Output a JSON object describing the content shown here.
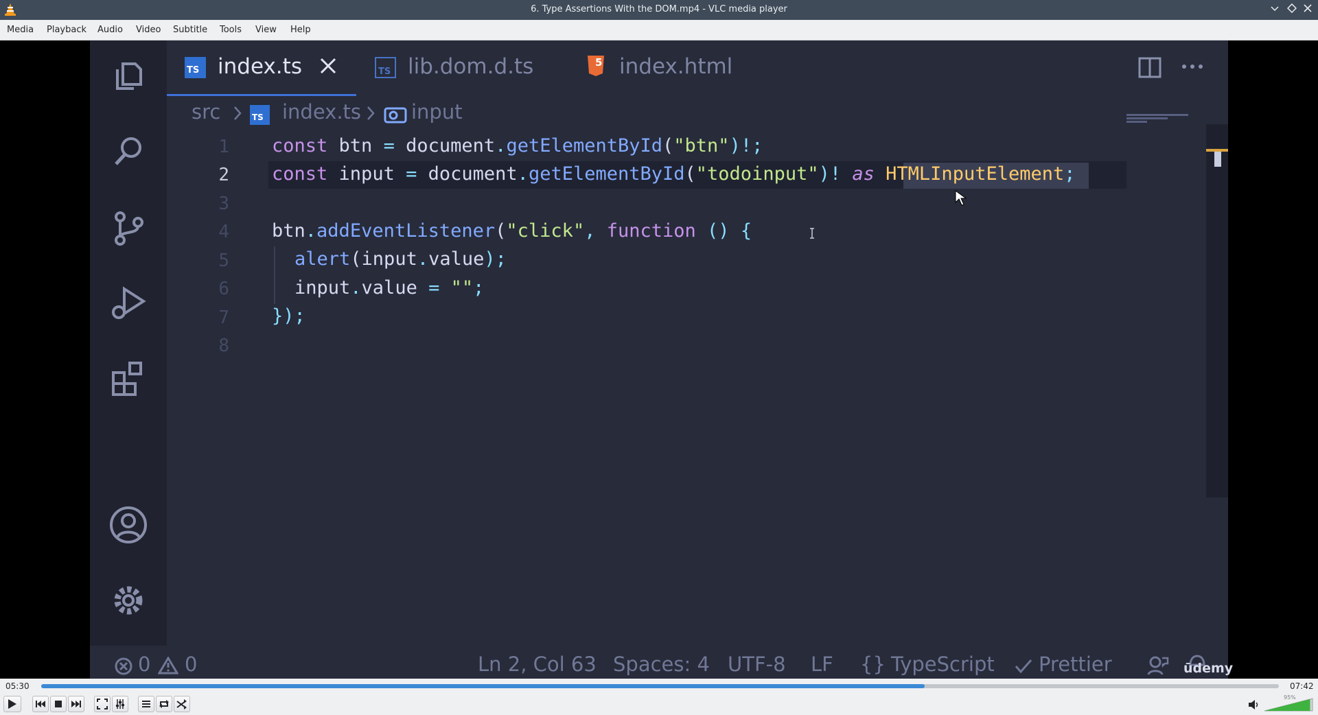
{
  "window": {
    "title": "6. Type Assertions With the DOM.mp4 - VLC media player",
    "app_icon": "vlc-cone-icon",
    "controls": [
      "minimize-icon",
      "maximize-icon",
      "close-icon"
    ]
  },
  "menu": [
    "Media",
    "Playback",
    "Audio",
    "Video",
    "Subtitle",
    "Tools",
    "View",
    "Help"
  ],
  "video_frame": {
    "activity_icons": [
      "explorer-icon",
      "search-icon",
      "source-control-icon",
      "run-debug-icon",
      "extensions-icon",
      "account-icon",
      "settings-gear-icon"
    ],
    "tabs": [
      {
        "label": "index.ts",
        "badge": "TS",
        "active": true
      },
      {
        "label": "lib.dom.d.ts",
        "badge": "TS",
        "active": false
      },
      {
        "label": "index.html",
        "badge": "5",
        "active": false
      }
    ],
    "breadcrumb": {
      "folder": "src",
      "file": "index.ts",
      "symbol": "input",
      "file_badge": "TS"
    },
    "line_numbers": [
      "1",
      "2",
      "3",
      "4",
      "5",
      "6",
      "7",
      "8"
    ],
    "current_line": 2,
    "code": {
      "l1": {
        "kw": "const",
        "name": "btn",
        "eq": "=",
        "obj": "document",
        "dot": ".",
        "fn": "getElementById",
        "open": "(",
        "str": "\"btn\"",
        "close": ")!;"
      },
      "l2": {
        "kw": "const",
        "name": "input",
        "eq": "=",
        "obj": "document",
        "dot": ".",
        "fn": "getElementById",
        "open": "(",
        "str": "\"todoinput\"",
        "close": ")!",
        "as": "as",
        "type": "HTMLInputElement",
        "semi": ";"
      },
      "l4": {
        "obj": "btn",
        "dot": ".",
        "fn": "addEventListener",
        "open": "(",
        "str": "\"click\"",
        "comma": ",",
        "kw": "function",
        "rest": "() {"
      },
      "l5": {
        "fn": "alert",
        "open": "(",
        "arg": "input",
        "dot": ".",
        "prop": "value",
        "close": ");"
      },
      "l6": {
        "obj": "input",
        "dot": ".",
        "prop": "value",
        "eq": "=",
        "str": "\"\"",
        "semi": ";"
      },
      "l7": {
        "text": "});"
      }
    },
    "status": {
      "errors": "0",
      "warnings": "0",
      "position": "Ln 2, Col 63",
      "spaces": "Spaces: 4",
      "encoding": "UTF-8",
      "eol": "LF",
      "language_braces": "{}",
      "language": "TypeScript",
      "prettier": "Prettier",
      "watermark": "ūdemy"
    }
  },
  "player": {
    "elapsed": "05:30",
    "total": "07:42",
    "progress_fraction": 0.714,
    "volume_label": "95%",
    "volume_fraction": 0.95,
    "accent_color": "#3b8ad6"
  }
}
